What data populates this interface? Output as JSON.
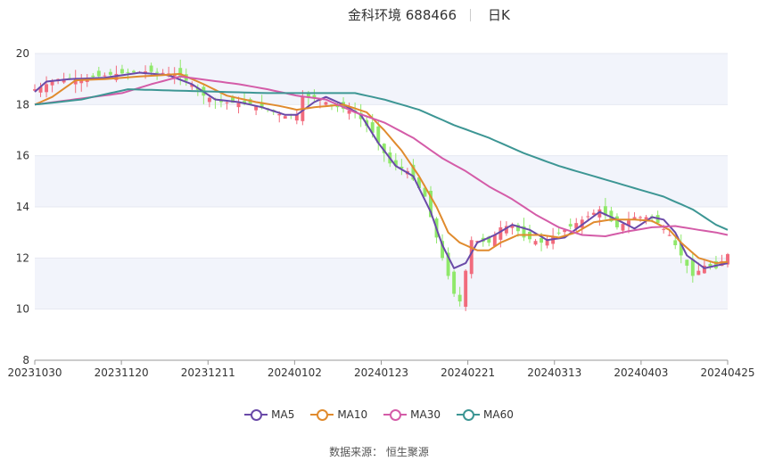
{
  "header": {
    "title": "金科环境 688466",
    "period": "日K"
  },
  "source": {
    "label": "数据来源：",
    "name": "恒生聚源"
  },
  "colors": {
    "up": "#f16b7d",
    "down": "#8fe86a",
    "grid_band": "#f2f4fb",
    "grid_line": "#e6e9f2",
    "axis": "#999999",
    "text": "#333333"
  },
  "chart_data": {
    "type": "candlestick",
    "title": "金科环境 688466",
    "subtitle": "日K",
    "ylim": [
      8,
      20
    ],
    "yticks": [
      8,
      10,
      12,
      14,
      16,
      18,
      20
    ],
    "xticks": [
      "20231030",
      "20231120",
      "20231211",
      "20240102",
      "20240123",
      "20240221",
      "20240313",
      "20240403",
      "20240425"
    ],
    "grid": true,
    "legend_position": "bottom",
    "count": 120,
    "anchors": [
      [
        0,
        18.6
      ],
      [
        4,
        19.0
      ],
      [
        9,
        19.05
      ],
      [
        14,
        19.2
      ],
      [
        19,
        19.3
      ],
      [
        24,
        19.2
      ],
      [
        27,
        18.8
      ],
      [
        29,
        18.35
      ],
      [
        32,
        18.1
      ],
      [
        36,
        18.05
      ],
      [
        40,
        17.8
      ],
      [
        43,
        17.55
      ],
      [
        45,
        17.6
      ],
      [
        46,
        18.3
      ],
      [
        49,
        18.2
      ],
      [
        52,
        17.9
      ],
      [
        55,
        17.7
      ],
      [
        58,
        16.9
      ],
      [
        61,
        15.7
      ],
      [
        64,
        15.4
      ],
      [
        67,
        14.4
      ],
      [
        70,
        12.0
      ],
      [
        72,
        10.6
      ],
      [
        73,
        10.3
      ],
      [
        75,
        12.7
      ],
      [
        78,
        12.6
      ],
      [
        80,
        13.2
      ],
      [
        82,
        13.3
      ],
      [
        84,
        12.8
      ],
      [
        87,
        12.6
      ],
      [
        91,
        13.1
      ],
      [
        94,
        13.5
      ],
      [
        97,
        13.9
      ],
      [
        100,
        13.2
      ],
      [
        103,
        13.6
      ],
      [
        106,
        13.6
      ],
      [
        109,
        12.9
      ],
      [
        111,
        12.1
      ],
      [
        113,
        11.3
      ],
      [
        115,
        11.7
      ],
      [
        117,
        11.6
      ],
      [
        119,
        12.15
      ]
    ],
    "series": [
      {
        "name": "MA5",
        "color": "#6a4aa8"
      },
      {
        "name": "MA10",
        "color": "#e08b2e"
      },
      {
        "name": "MA30",
        "color": "#d45ca8"
      },
      {
        "name": "MA60",
        "color": "#3d9694"
      }
    ],
    "ma_anchors": {
      "MA5": [
        [
          0,
          18.5
        ],
        [
          2,
          18.9
        ],
        [
          6,
          19.0
        ],
        [
          12,
          19.05
        ],
        [
          18,
          19.25
        ],
        [
          23,
          19.15
        ],
        [
          27,
          18.8
        ],
        [
          31,
          18.2
        ],
        [
          35,
          18.1
        ],
        [
          39,
          17.9
        ],
        [
          43,
          17.6
        ],
        [
          45,
          17.6
        ],
        [
          48,
          18.1
        ],
        [
          50,
          18.3
        ],
        [
          53,
          18.0
        ],
        [
          56,
          17.6
        ],
        [
          59,
          16.5
        ],
        [
          62,
          15.6
        ],
        [
          65,
          15.2
        ],
        [
          68,
          13.8
        ],
        [
          70,
          12.5
        ],
        [
          72,
          11.6
        ],
        [
          74,
          11.8
        ],
        [
          76,
          12.6
        ],
        [
          79,
          12.9
        ],
        [
          82,
          13.3
        ],
        [
          85,
          13.1
        ],
        [
          88,
          12.7
        ],
        [
          91,
          12.8
        ],
        [
          94,
          13.3
        ],
        [
          97,
          13.8
        ],
        [
          100,
          13.5
        ],
        [
          103,
          13.15
        ],
        [
          106,
          13.6
        ],
        [
          108,
          13.5
        ],
        [
          110,
          13.0
        ],
        [
          112,
          12.1
        ],
        [
          115,
          11.6
        ],
        [
          117,
          11.7
        ],
        [
          119,
          11.8
        ]
      ],
      "MA10": [
        [
          0,
          18.0
        ],
        [
          3,
          18.3
        ],
        [
          7,
          18.95
        ],
        [
          12,
          19.0
        ],
        [
          18,
          19.1
        ],
        [
          25,
          19.2
        ],
        [
          29,
          18.8
        ],
        [
          33,
          18.35
        ],
        [
          38,
          18.1
        ],
        [
          42,
          17.95
        ],
        [
          45,
          17.8
        ],
        [
          48,
          17.9
        ],
        [
          53,
          18.0
        ],
        [
          57,
          17.7
        ],
        [
          60,
          17.0
        ],
        [
          63,
          16.2
        ],
        [
          66,
          15.2
        ],
        [
          69,
          14.0
        ],
        [
          71,
          13.0
        ],
        [
          73,
          12.6
        ],
        [
          76,
          12.3
        ],
        [
          78,
          12.3
        ],
        [
          80,
          12.6
        ],
        [
          83,
          12.9
        ],
        [
          87,
          12.9
        ],
        [
          90,
          12.8
        ],
        [
          93,
          13.0
        ],
        [
          96,
          13.4
        ],
        [
          99,
          13.5
        ],
        [
          103,
          13.5
        ],
        [
          106,
          13.45
        ],
        [
          109,
          13.1
        ],
        [
          111,
          12.6
        ],
        [
          114,
          12.0
        ],
        [
          117,
          11.8
        ],
        [
          119,
          11.85
        ]
      ],
      "MA30": [
        [
          0,
          18.0
        ],
        [
          5,
          18.15
        ],
        [
          10,
          18.3
        ],
        [
          15,
          18.45
        ],
        [
          20,
          18.8
        ],
        [
          25,
          19.1
        ],
        [
          30,
          18.95
        ],
        [
          35,
          18.8
        ],
        [
          40,
          18.6
        ],
        [
          45,
          18.35
        ],
        [
          50,
          18.2
        ],
        [
          55,
          17.7
        ],
        [
          60,
          17.3
        ],
        [
          65,
          16.7
        ],
        [
          70,
          15.9
        ],
        [
          74,
          15.4
        ],
        [
          78,
          14.8
        ],
        [
          82,
          14.3
        ],
        [
          86,
          13.7
        ],
        [
          90,
          13.2
        ],
        [
          94,
          12.9
        ],
        [
          98,
          12.85
        ],
        [
          102,
          13.05
        ],
        [
          106,
          13.2
        ],
        [
          110,
          13.25
        ],
        [
          114,
          13.1
        ],
        [
          117,
          13.0
        ],
        [
          119,
          12.9
        ]
      ],
      "MA60": [
        [
          0,
          18.0
        ],
        [
          8,
          18.2
        ],
        [
          16,
          18.6
        ],
        [
          24,
          18.55
        ],
        [
          32,
          18.5
        ],
        [
          40,
          18.45
        ],
        [
          48,
          18.45
        ],
        [
          55,
          18.45
        ],
        [
          60,
          18.2
        ],
        [
          66,
          17.8
        ],
        [
          72,
          17.2
        ],
        [
          78,
          16.7
        ],
        [
          84,
          16.1
        ],
        [
          90,
          15.6
        ],
        [
          96,
          15.2
        ],
        [
          102,
          14.8
        ],
        [
          108,
          14.4
        ],
        [
          113,
          13.9
        ],
        [
          117,
          13.3
        ],
        [
          119,
          13.1
        ]
      ]
    }
  }
}
